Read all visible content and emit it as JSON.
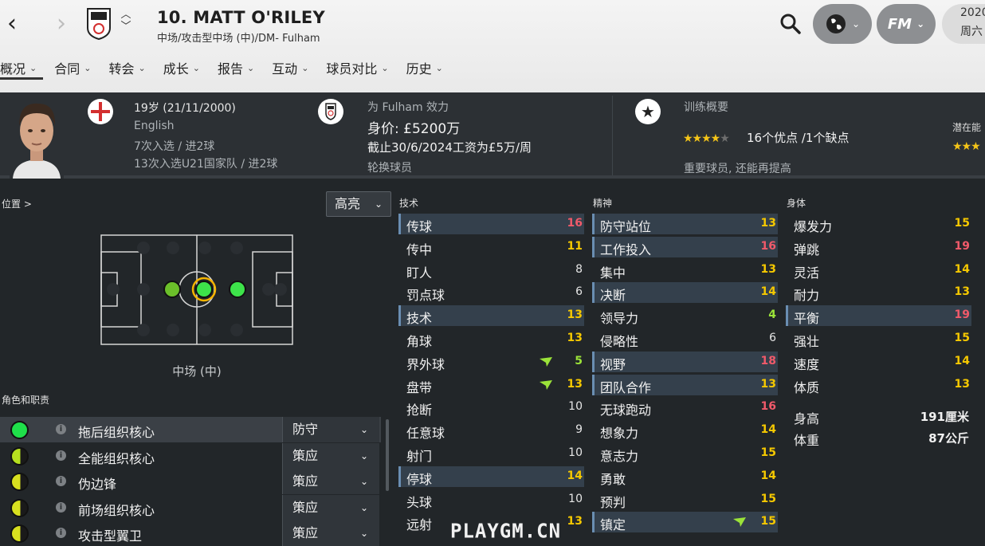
{
  "header": {
    "title": "10. MATT O'RILEY",
    "subtitle": "中场/攻击型中场 (中)/DM- Fulham",
    "date_line1": "2020",
    "date_line2": "周六",
    "fm_label": "FM"
  },
  "tabs": [
    "概况",
    "合同",
    "转会",
    "成长",
    "报告",
    "互动",
    "球员对比",
    "历史"
  ],
  "info": {
    "age": "19岁 (21/11/2000)",
    "nationality": "English",
    "caps": "7次入选 / 进2球",
    "u21_caps": "13次入选U21国家队 / 进2球",
    "club_line": "为 Fulham 效力",
    "value": "身价: £5200万",
    "contract": "截止30/6/2024工资为£5万/周",
    "squad_status": "轮换球员",
    "training_title": "训练概要",
    "training_stars": 4,
    "strengths": "16个优点 /1个缺点",
    "training_note": "重要球员, 还能再提高",
    "potential_label": "潜在能"
  },
  "position_panel": {
    "label": "位置 >",
    "highlight_label": "高亮",
    "position_name": "中场 (中)",
    "roles_label": "角色和职责",
    "roles": [
      {
        "name": "拖后组织核心",
        "duty": "防守",
        "color": "#1fe04a",
        "half": false
      },
      {
        "name": "全能组织核心",
        "duty": "策应",
        "color": "#b6e01f",
        "half": true
      },
      {
        "name": "伪边锋",
        "duty": "策应",
        "color": "#d8e01f",
        "half": true
      },
      {
        "name": "前场组织核心",
        "duty": "策应",
        "color": "#d8e01f",
        "half": true
      },
      {
        "name": "攻击型翼卫",
        "duty": "策应",
        "color": "#d8e01f",
        "half": true
      }
    ]
  },
  "attributes": {
    "technical_label": "技术",
    "mental_label": "精神",
    "physical_label": "身体",
    "technical": [
      {
        "name": "传球",
        "value": "16",
        "hl": true
      },
      {
        "name": "传中",
        "value": "11",
        "hl": false
      },
      {
        "name": "盯人",
        "value": "8",
        "hl": false
      },
      {
        "name": "罚点球",
        "value": "6",
        "hl": false
      },
      {
        "name": "技术",
        "value": "13",
        "hl": true
      },
      {
        "name": "角球",
        "value": "13",
        "hl": false
      },
      {
        "name": "界外球",
        "value": "5",
        "hl": false,
        "arrow": true
      },
      {
        "name": "盘带",
        "value": "13",
        "hl": false,
        "arrow": true
      },
      {
        "name": "抢断",
        "value": "10",
        "hl": false
      },
      {
        "name": "任意球",
        "value": "9",
        "hl": false
      },
      {
        "name": "射门",
        "value": "10",
        "hl": false
      },
      {
        "name": "停球",
        "value": "14",
        "hl": true
      },
      {
        "name": "头球",
        "value": "10",
        "hl": false
      },
      {
        "name": "远射",
        "value": "13",
        "hl": false
      }
    ],
    "mental": [
      {
        "name": "防守站位",
        "value": "13",
        "hl": true
      },
      {
        "name": "工作投入",
        "value": "16",
        "hl": true
      },
      {
        "name": "集中",
        "value": "13",
        "hl": false
      },
      {
        "name": "决断",
        "value": "14",
        "hl": true
      },
      {
        "name": "领导力",
        "value": "4",
        "hl": false
      },
      {
        "name": "侵略性",
        "value": "6",
        "hl": false
      },
      {
        "name": "视野",
        "value": "18",
        "hl": true
      },
      {
        "name": "团队合作",
        "value": "13",
        "hl": true
      },
      {
        "name": "无球跑动",
        "value": "16",
        "hl": false
      },
      {
        "name": "想象力",
        "value": "14",
        "hl": false
      },
      {
        "name": "意志力",
        "value": "15",
        "hl": false
      },
      {
        "name": "勇敢",
        "value": "14",
        "hl": false
      },
      {
        "name": "预判",
        "value": "15",
        "hl": false
      },
      {
        "name": "镇定",
        "value": "15",
        "hl": true,
        "arrow": true
      }
    ],
    "physical": [
      {
        "name": "爆发力",
        "value": "15",
        "hl": false
      },
      {
        "name": "弹跳",
        "value": "19",
        "hl": false
      },
      {
        "name": "灵活",
        "value": "14",
        "hl": false
      },
      {
        "name": "耐力",
        "value": "13",
        "hl": false
      },
      {
        "name": "平衡",
        "value": "19",
        "hl": true
      },
      {
        "name": "强壮",
        "value": "15",
        "hl": false
      },
      {
        "name": "速度",
        "value": "14",
        "hl": false
      },
      {
        "name": "体质",
        "value": "13",
        "hl": false
      }
    ],
    "height_label": "身高",
    "height": "191厘米",
    "weight_label": "体重",
    "weight": "87公斤"
  },
  "watermark": "PLAYGM.CN",
  "colors": {
    "accent_yellow": "#f5c800",
    "accent_green": "#9be339",
    "accent_red": "#f05a6a",
    "highlight": "#34404c"
  }
}
